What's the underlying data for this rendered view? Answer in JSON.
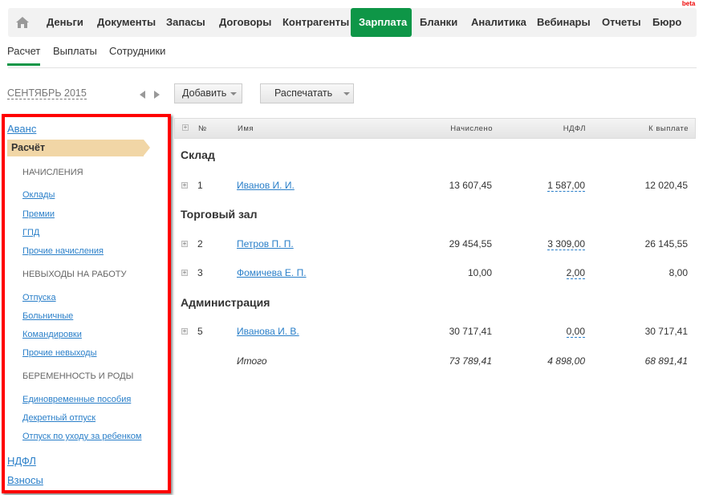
{
  "nav": {
    "items": [
      "Деньги",
      "Документы",
      "Запасы",
      "Договоры",
      "Контрагенты",
      "Зарплата",
      "Бланки",
      "Аналитика",
      "Вебинары",
      "Отчеты",
      "Бюро"
    ],
    "active": "Зарплата",
    "beta": "beta",
    "accent": "#0e9647"
  },
  "subtabs": [
    "Расчет",
    "Выплаты",
    "Сотрудники"
  ],
  "period": "СЕНТЯБРЬ 2015",
  "toolbar": {
    "add": "Добавить",
    "print": "Распечатать"
  },
  "sidebar": {
    "top": "Аванс",
    "active": "Расчёт",
    "sections": [
      {
        "title": "НАЧИСЛЕНИЯ",
        "links": [
          "Оклады",
          "Премии",
          "ГПД",
          "Прочие начисления"
        ]
      },
      {
        "title": "НЕВЫХОДЫ НА РАБОТУ",
        "links": [
          "Отпуска",
          "Больничные",
          "Командировки",
          "Прочие невыходы"
        ]
      },
      {
        "title": "БЕРЕМЕННОСТЬ И РОДЫ",
        "links": [
          "Единовременные пособия",
          "Декретный отпуск",
          "Отпуск по уходу за ребенком"
        ]
      }
    ],
    "bottom": [
      "НДФЛ",
      "Взносы"
    ]
  },
  "table": {
    "headers": {
      "num": "№",
      "name": "Имя",
      "accrued": "Начислено",
      "ndfl": "НДФЛ",
      "payout": "К выплате"
    },
    "groups": [
      "Склад",
      "Торговый зал",
      "Администрация"
    ],
    "rows": [
      {
        "num": "1",
        "name": "Иванов И. И.",
        "accrued": "13 607,45",
        "ndfl": "1 587,00",
        "payout": "12 020,45"
      },
      {
        "num": "2",
        "name": "Петров П. П.",
        "accrued": "29 454,55",
        "ndfl": "3 309,00",
        "payout": "26 145,55"
      },
      {
        "num": "3",
        "name": "Фомичева Е. П.",
        "accrued": "10,00",
        "ndfl": "2,00",
        "payout": "8,00"
      },
      {
        "num": "5",
        "name": "Иванова И. В.",
        "accrued": "30 717,41",
        "ndfl": "0,00",
        "payout": "30 717,41"
      }
    ],
    "total": {
      "label": "Итого",
      "accrued": "73 789,41",
      "ndfl": "4 898,00",
      "payout": "68 891,41"
    }
  }
}
